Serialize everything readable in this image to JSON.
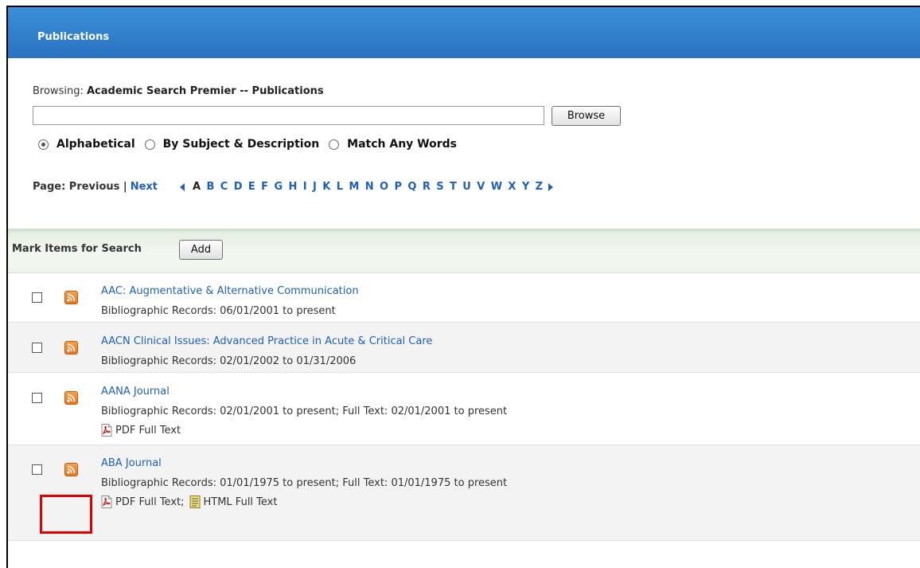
{
  "header": {
    "title": "Publications"
  },
  "browse": {
    "browsing_label": "Browsing:",
    "database": "Academic Search Premier -- Publications",
    "search_value": "",
    "browse_button": "Browse",
    "radios": [
      {
        "label": "Alphabetical",
        "checked": true
      },
      {
        "label": "By Subject & Description",
        "checked": false
      },
      {
        "label": "Match Any Words",
        "checked": false
      }
    ],
    "page_label": "Page: Previous |",
    "next_label": "Next",
    "letters": [
      "A",
      "B",
      "C",
      "D",
      "E",
      "F",
      "G",
      "H",
      "I",
      "J",
      "K",
      "L",
      "M",
      "N",
      "O",
      "P",
      "Q",
      "R",
      "S",
      "T",
      "U",
      "V",
      "W",
      "X",
      "Y",
      "Z"
    ],
    "current_letter": "A"
  },
  "mark": {
    "label": "Mark Items for Search",
    "add_button": "Add"
  },
  "results": [
    {
      "title": "AAC: Augmentative & Alternative Communication",
      "info": "Bibliographic Records: 06/01/2001 to present"
    },
    {
      "title": "AACN Clinical Issues: Advanced Practice in Acute & Critical Care",
      "info": "Bibliographic Records: 02/01/2002 to 01/31/2006"
    },
    {
      "title": "AANA Journal",
      "info": "Bibliographic Records: 02/01/2001 to present; Full Text: 02/01/2001 to present",
      "fulltext": "PDF Full Text"
    },
    {
      "title": "ABA Journal",
      "info": "Bibliographic Records: 01/01/1975 to present; Full Text: 01/01/1975 to present",
      "fulltext_pdf": "PDF Full Text;",
      "fulltext_html": "HTML Full Text"
    }
  ],
  "colors": {
    "header_blue": "#2a73c2",
    "link_blue": "#1f5fb8",
    "rss_orange": "#e8731b",
    "highlight_red": "#e00000"
  }
}
